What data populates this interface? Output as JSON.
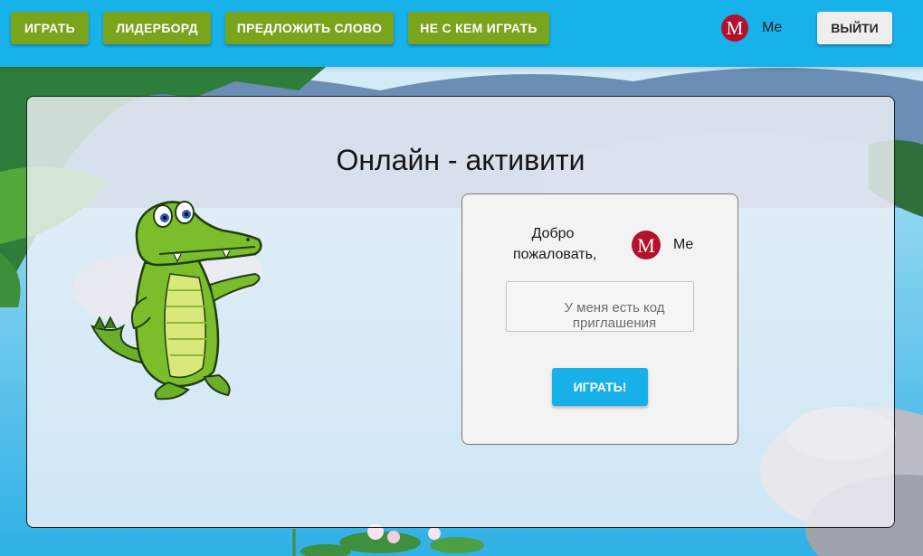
{
  "nav": {
    "play_label": "ИГРАТЬ",
    "leaderboard_label": "ЛИДЕРБОРД",
    "suggest_label": "ПРЕДЛОЖИТЬ СЛОВО",
    "nobody_label": "НЕ С КЕМ ИГРАТЬ"
  },
  "user": {
    "name": "Me",
    "avatar_letter": "M",
    "avatar_color": "#b5102c"
  },
  "header": {
    "logout_label": "ВЫЙТИ"
  },
  "main": {
    "title": "Онлайн - активити",
    "welcome_text": "Добро пожаловать,",
    "invite_label": "У меня есть код приглашения",
    "play_button": "ИГРАТЬ!"
  },
  "colors": {
    "topbar": "#18b2ea",
    "nav_button": "#7aa41c",
    "play_button": "#17b0e8"
  }
}
